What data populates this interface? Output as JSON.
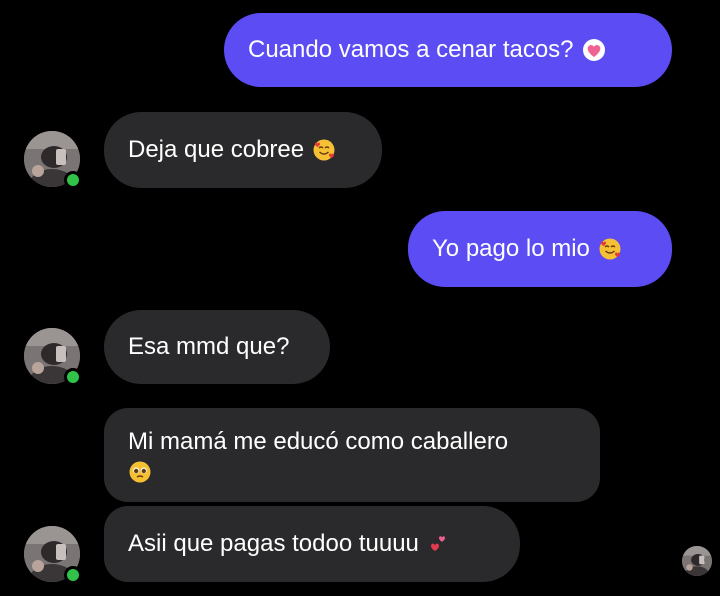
{
  "conversation": {
    "messages": [
      {
        "from": "me",
        "text": "Cuando vamos a cenar tacos?",
        "emoji": "heart-emoji"
      },
      {
        "from": "contact",
        "text": "Deja que cobree",
        "emoji": "smiling-face-with-hearts-emoji"
      },
      {
        "from": "me",
        "text": "Yo pago lo mio",
        "emoji": "smiling-face-with-hearts-emoji"
      },
      {
        "from": "contact",
        "text": "Esa mmd que?"
      },
      {
        "from": "contact",
        "text": "Mi mamá me educó como caballero",
        "emoji": "pleading-face-emoji"
      },
      {
        "from": "contact",
        "text": "Asii que pagas todoo tuuuu",
        "emoji": "two-hearts-emoji"
      }
    ]
  },
  "colors": {
    "background": "#000000",
    "sent_bubble": "#5b4cf4",
    "received_bubble": "#2a2a2c",
    "text": "#ffffff",
    "online_indicator": "#31c24a"
  },
  "contact": {
    "avatar_icon": "contact-avatar",
    "status": "online"
  }
}
